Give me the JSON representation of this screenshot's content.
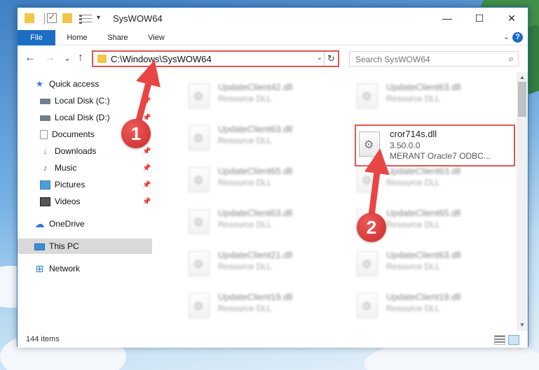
{
  "window": {
    "title": "SysWOW64",
    "controls": {
      "minimize": "—",
      "maximize": "☐",
      "close": "✕"
    }
  },
  "ribbon": {
    "tabs": [
      "File",
      "Home",
      "Share",
      "View"
    ],
    "help": "?"
  },
  "toolbar": {
    "back": "←",
    "forward": "→",
    "recent": "⌄",
    "up": "↑",
    "address": "C:\\Windows\\SysWOW64",
    "search_placeholder": "Search SysWOW64"
  },
  "nav": {
    "quick_access": "Quick access",
    "items": [
      "Local Disk (C:)",
      "Local Disk (D:)",
      "Documents",
      "Downloads",
      "Music",
      "Pictures",
      "Videos"
    ],
    "onedrive": "OneDrive",
    "this_pc": "This PC",
    "network": "Network"
  },
  "files": {
    "left": [
      {
        "name": "UpdateClient42.dll",
        "type": "Resource DLL"
      },
      {
        "name": "UpdateClient63.dll",
        "type": "Resource DLL"
      },
      {
        "name": "UpdateClient65.dll",
        "type": "Resource DLL"
      },
      {
        "name": "UpdateClient63.dll",
        "type": "Resource DLL"
      },
      {
        "name": "UpdateClient21.dll",
        "type": "Resource DLL"
      },
      {
        "name": "UpdateClient19.dll",
        "type": "Resource DLL"
      }
    ],
    "right": [
      {
        "name": "UpdateClient63.dll",
        "type": "Resource DLL"
      },
      {
        "name": "UpdateClient63.dll",
        "type": "Resource DLL"
      },
      {
        "name": "UpdateClient65.dll",
        "type": "Resource DLL"
      },
      {
        "name": "UpdateClient63.dll",
        "type": "Resource DLL"
      },
      {
        "name": "UpdateClient19.dll",
        "type": "Resource DLL"
      }
    ],
    "highlighted": {
      "name": "cror714s.dll",
      "version": "3.50.0.0",
      "description": "MERANT Oracle7 ODBC..."
    }
  },
  "status": {
    "count": "144 items"
  },
  "callouts": [
    "1",
    "2"
  ],
  "colors": {
    "accent": "#1b6ec2",
    "highlight": "#e05555"
  }
}
